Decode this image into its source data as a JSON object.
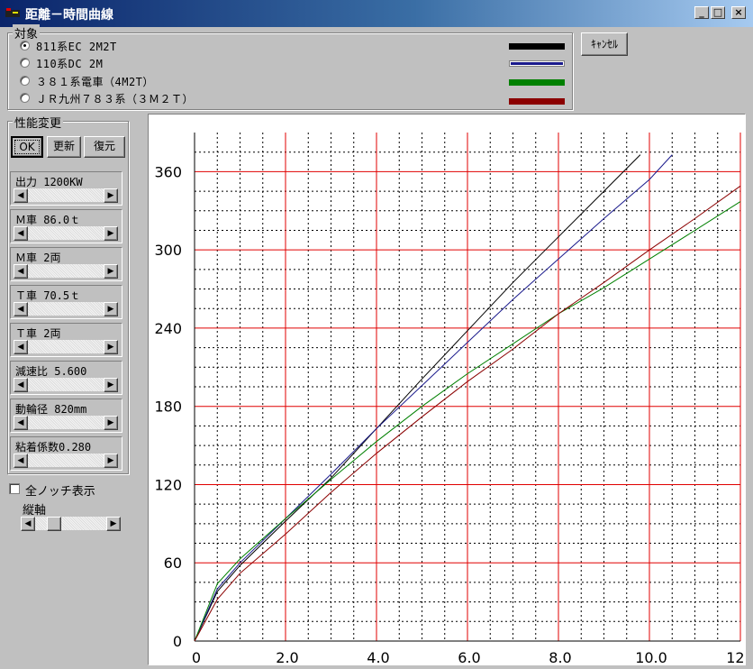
{
  "window": {
    "title": "距離－時間曲線",
    "controls": {
      "minimize": "_",
      "maximize": "□",
      "close": "×"
    }
  },
  "target_group": {
    "label": "対象",
    "options": [
      {
        "label": "811系EC  2M2T",
        "selected": true,
        "color": "#000000"
      },
      {
        "label": "110系DC 2M",
        "selected": false,
        "color": "#1a1a8c"
      },
      {
        "label": "３８１系電車（4M2T）",
        "selected": false,
        "color": "#008000"
      },
      {
        "label": "ＪＲ九州７８３系（３Ｍ２Ｔ）",
        "selected": false,
        "color": "#8b0000"
      }
    ]
  },
  "cancel_button": "ｷｬﾝｾﾙ",
  "perf_group": {
    "label": "性能変更",
    "ok": "OK",
    "update": "更新",
    "restore": "復元",
    "params": [
      {
        "label": "出力  1200KW",
        "position": 0.0
      },
      {
        "label": "Ｍ車  86.0ｔ",
        "position": 0.0
      },
      {
        "label": "Ｍ車     2両",
        "position": 0.0
      },
      {
        "label": "Ｔ車  70.5ｔ",
        "position": 0.0
      },
      {
        "label": "Ｔ車     2両",
        "position": 0.0
      },
      {
        "label": "減速比 5.600",
        "position": 0.0
      },
      {
        "label": "動輪径  820mm",
        "position": 0.0
      },
      {
        "label": "粘着係数0.280",
        "position": 0.0
      }
    ]
  },
  "all_notch": {
    "label": "全ノッチ表示",
    "checked": false
  },
  "vertical_axis": {
    "label": "縦軸",
    "position": 0.2
  },
  "chart_data": {
    "type": "line",
    "ylim": [
      0,
      390
    ],
    "xlim": [
      0,
      12.0
    ],
    "y_ticks": [
      0,
      60,
      120,
      180,
      240,
      300,
      360
    ],
    "x_ticks": [
      "0",
      "2.0",
      "4.0",
      "6.0",
      "8.0",
      "10.0",
      "12.0"
    ],
    "grid": true,
    "series": [
      {
        "color": "#000000",
        "x": [
          0,
          0.5,
          1,
          2,
          3,
          4,
          5,
          6,
          7,
          8,
          9,
          9.8
        ],
        "y": [
          0,
          38,
          58,
          92,
          125,
          163,
          201,
          238,
          275,
          310,
          345,
          373
        ]
      },
      {
        "color": "#1a1a8c",
        "x": [
          0,
          0.5,
          1,
          2,
          3,
          4,
          5,
          6,
          7,
          8,
          9,
          10,
          10.5
        ],
        "y": [
          0,
          40,
          60,
          94,
          128,
          163,
          196,
          229,
          262,
          293,
          324,
          354,
          373
        ]
      },
      {
        "color": "#008000",
        "x": [
          0,
          0.5,
          1,
          2,
          3,
          4,
          5,
          6,
          7,
          8,
          9,
          10,
          11,
          12
        ],
        "y": [
          0,
          44,
          63,
          94,
          124,
          153,
          180,
          205,
          228,
          251,
          271,
          293,
          315,
          337
        ]
      },
      {
        "color": "#8b0000",
        "x": [
          0,
          0.5,
          1,
          2,
          3,
          4,
          5,
          6,
          7,
          8,
          9,
          10,
          11,
          12
        ],
        "y": [
          0,
          32,
          52,
          82,
          114,
          144,
          172,
          199,
          224,
          251,
          275,
          300,
          324,
          349
        ]
      }
    ]
  }
}
